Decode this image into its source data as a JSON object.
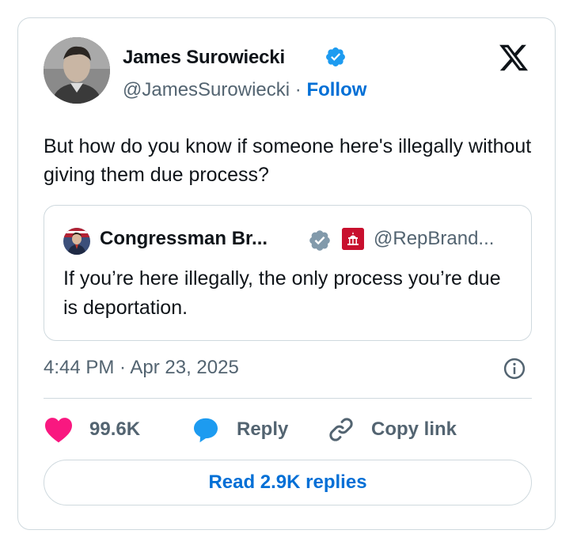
{
  "author": {
    "name": "James Surowiecki",
    "handle": "@JamesSurowiecki",
    "separator": "·",
    "follow_label": "Follow"
  },
  "tweet": {
    "text": "But how do you know if someone here's illegally without giving them due process?"
  },
  "quoted": {
    "name": "Congressman Br...",
    "handle": "@RepBrand...",
    "text": "If you’re here illegally, the only process you’re due is deportation."
  },
  "timestamp": "4:44 PM · Apr 23, 2025",
  "actions": {
    "like_count": "99.6K",
    "reply_label": "Reply",
    "copy_label": "Copy link"
  },
  "read_replies_label": "Read 2.9K replies",
  "colors": {
    "accent": "#1d9bf0",
    "follow": "#006fd6",
    "like": "#f91880",
    "muted": "#536471",
    "border": "#cfd9de",
    "verified_gray": "#829aab"
  },
  "icons": [
    "verified-badge-icon",
    "x-logo-icon",
    "info-icon",
    "heart-icon",
    "reply-bubble-icon",
    "link-icon"
  ]
}
